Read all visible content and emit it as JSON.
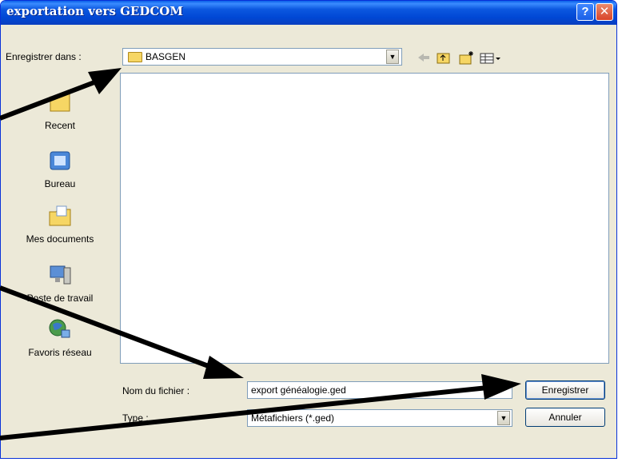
{
  "title": "exportation vers GEDCOM",
  "title_buttons": {
    "help": "?",
    "close": "✕"
  },
  "save_in": {
    "label": "Enregistrer dans :",
    "value": "BASGEN"
  },
  "toolbar_icons": [
    "back-icon",
    "up-folder-icon",
    "new-folder-icon",
    "view-menu-icon"
  ],
  "places": [
    {
      "label": "Recent",
      "icon": "recent-folder-icon"
    },
    {
      "label": "Bureau",
      "icon": "desktop-icon"
    },
    {
      "label": "Mes documents",
      "icon": "my-documents-icon"
    },
    {
      "label": "Poste de travail",
      "icon": "my-computer-icon"
    },
    {
      "label": "Favoris réseau",
      "icon": "network-icon"
    }
  ],
  "filename": {
    "label": "Nom du fichier :",
    "value": "export généalogie.ged"
  },
  "filetype": {
    "label": "Type :",
    "value": "Métafichiers (*.ged)"
  },
  "buttons": {
    "save": "Enregistrer",
    "cancel": "Annuler"
  },
  "colors": {
    "titlebar": "#0a5fe8",
    "dialog": "#ece9d8",
    "border": "#7f9db9"
  }
}
